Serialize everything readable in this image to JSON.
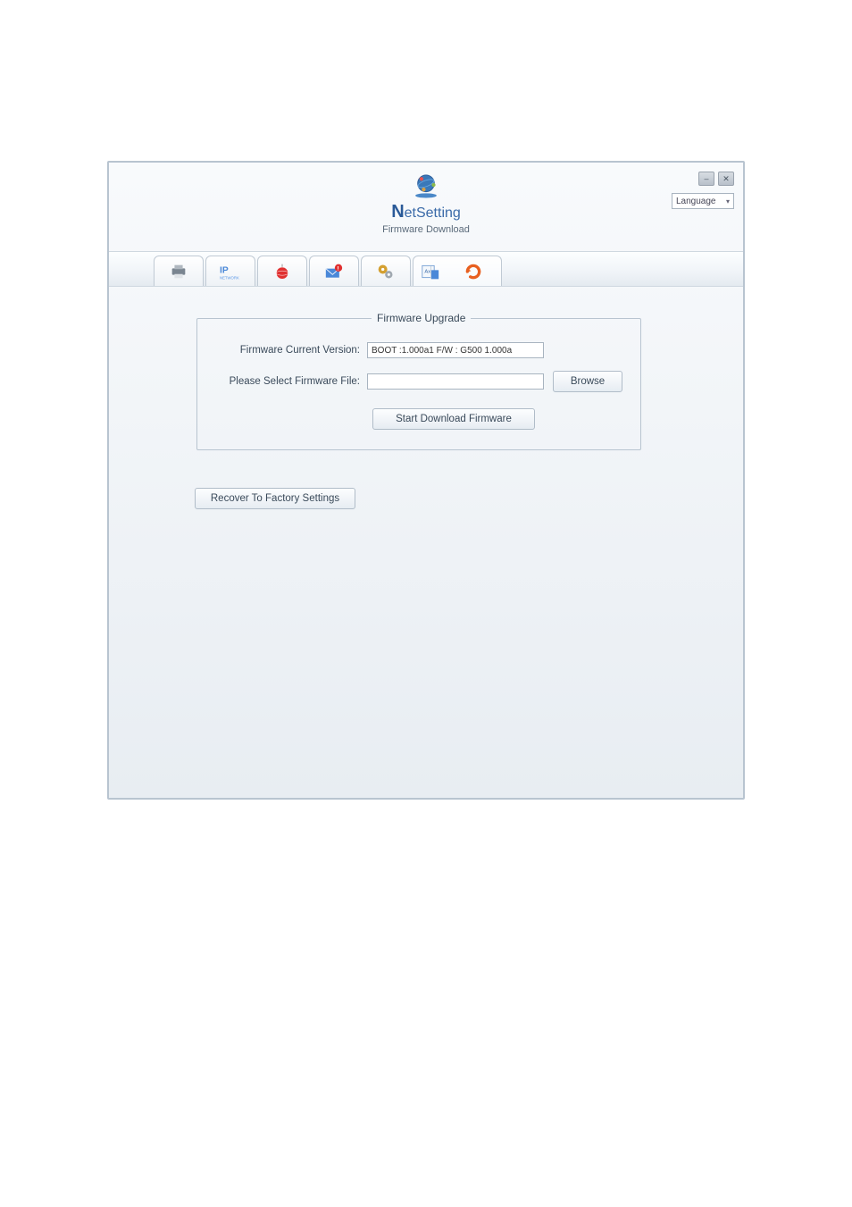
{
  "header": {
    "app_title_prefix": "N",
    "app_title_rest": "etSetting",
    "subtitle": "Firmware Download"
  },
  "window": {
    "language_label": "Language"
  },
  "tabs": {
    "printer_icon": "printer-icon",
    "ip_icon": "ip-network-icon",
    "globe_icon": "globe-icon",
    "mail_icon": "mail-alert-icon",
    "gears_icon": "gears-icon",
    "terminal_icon": "terminal-file-icon",
    "refresh_arrow_icon": "refresh-arrow-icon"
  },
  "firmware": {
    "legend": "Firmware Upgrade",
    "current_version_label": "Firmware Current Version:",
    "current_version_value": "BOOT :1.000a1  F/W : G500 1.000a",
    "select_file_label": "Please Select Firmware File:",
    "selected_file_value": "",
    "browse_label": "Browse",
    "start_label": "Start Download Firmware"
  },
  "recover": {
    "button_label": "Recover To Factory  Settings"
  }
}
